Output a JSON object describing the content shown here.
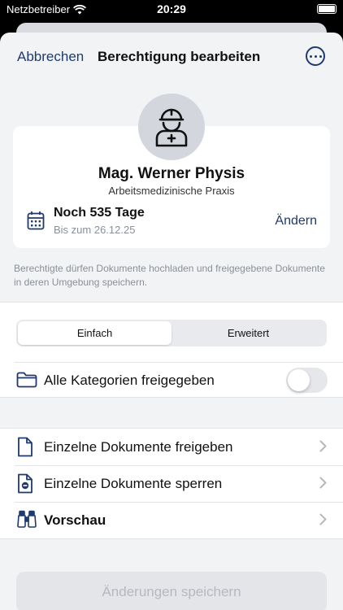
{
  "status": {
    "carrier": "Netzbetreiber",
    "time": "20:29"
  },
  "nav": {
    "cancel": "Abbrechen",
    "title": "Berechtigung bearbeiten",
    "more_icon": "ellipsis-circle-icon"
  },
  "profile": {
    "avatar_icon": "doctor-icon",
    "name": "Mag. Werner Physis",
    "subtitle": "Arbeitsmedizinische Praxis",
    "validity": {
      "icon": "calendar-icon",
      "days": "Noch 535 Tage",
      "until": "Bis zum 26.12.25",
      "change": "Ändern"
    }
  },
  "note": "Berechtigte dürfen Dokumente hochladen und freigegebene Dokumente in deren Umgebung speichern.",
  "segments": [
    {
      "label": "Einfach",
      "selected": true
    },
    {
      "label": "Erweitert",
      "selected": false
    }
  ],
  "all_categories": {
    "icon": "folder-icon",
    "label": "Alle Kategorien freigegeben",
    "enabled": false
  },
  "actions": [
    {
      "icon": "document-icon",
      "label": "Einzelne Dokumente freigeben"
    },
    {
      "icon": "document-blocked-icon",
      "label": "Einzelne Dokumente sperren"
    },
    {
      "icon": "binoculars-icon",
      "label": "Vorschau"
    }
  ],
  "save_button": "Änderungen speichern",
  "colors": {
    "accent": "#1f3a6e",
    "background": "#f2f3f5",
    "muted": "#8a8f98"
  }
}
